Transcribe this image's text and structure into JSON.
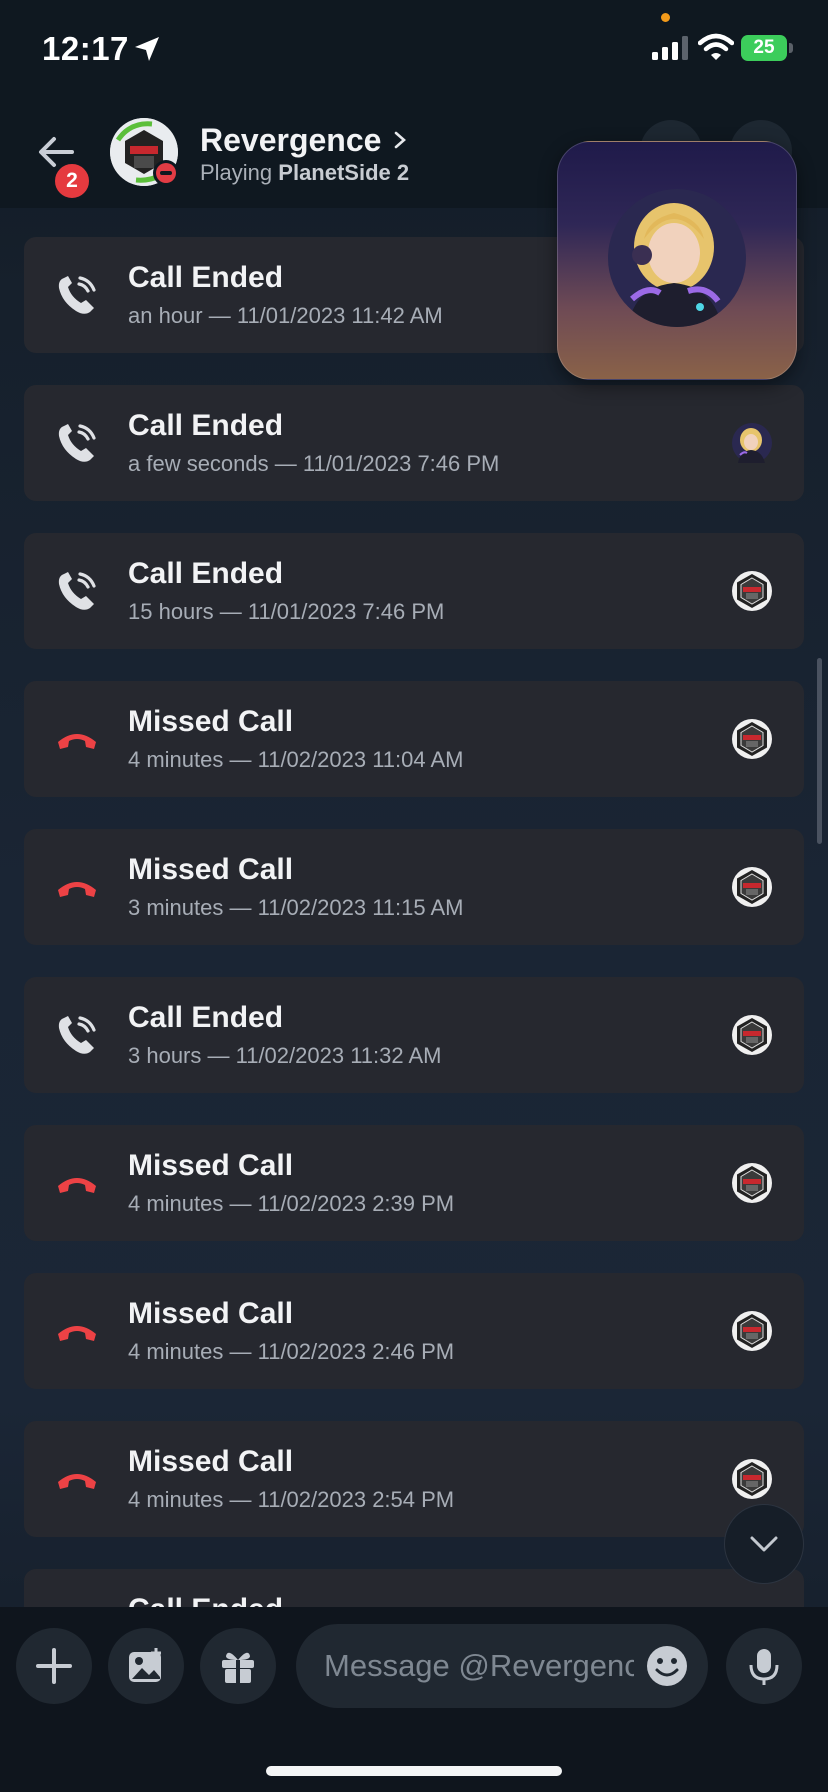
{
  "status_bar": {
    "time": "12:17",
    "battery": "25",
    "accent": "#3ccd5b"
  },
  "header": {
    "name": "Revergence",
    "activity_prefix": "Playing",
    "activity_game": "PlanetSide 2",
    "back_badge": "2",
    "status": "do-not-disturb"
  },
  "calls": [
    {
      "type": "ended",
      "title": "Call Ended",
      "subtitle": "an hour — 11/01/2023 11:42 AM",
      "participant": "pip-covered"
    },
    {
      "type": "ended",
      "title": "Call Ended",
      "subtitle": "a few seconds — 11/01/2023 7:46 PM",
      "participant": "anime-avatar"
    },
    {
      "type": "ended",
      "title": "Call Ended",
      "subtitle": "15 hours — 11/01/2023 7:46 PM",
      "participant": "hex-avatar"
    },
    {
      "type": "missed",
      "title": "Missed Call",
      "subtitle": "4 minutes — 11/02/2023 11:04 AM",
      "participant": "hex-avatar"
    },
    {
      "type": "missed",
      "title": "Missed Call",
      "subtitle": "3 minutes — 11/02/2023 11:15 AM",
      "participant": "hex-avatar"
    },
    {
      "type": "ended",
      "title": "Call Ended",
      "subtitle": "3 hours — 11/02/2023 11:32 AM",
      "participant": "hex-avatar"
    },
    {
      "type": "missed",
      "title": "Missed Call",
      "subtitle": "4 minutes — 11/02/2023 2:39 PM",
      "participant": "hex-avatar"
    },
    {
      "type": "missed",
      "title": "Missed Call",
      "subtitle": "4 minutes — 11/02/2023 2:46 PM",
      "participant": "hex-avatar"
    },
    {
      "type": "missed",
      "title": "Missed Call",
      "subtitle": "4 minutes — 11/02/2023 2:54 PM",
      "participant": "hex-avatar"
    },
    {
      "type": "ended",
      "title": "Call Ended",
      "subtitle": "",
      "participant": "anime-avatar"
    }
  ],
  "composer": {
    "placeholder": "Message @Revergence"
  },
  "colors": {
    "missed": "#ed4245",
    "ended": "#dfe1e5",
    "card": "#26282f"
  }
}
